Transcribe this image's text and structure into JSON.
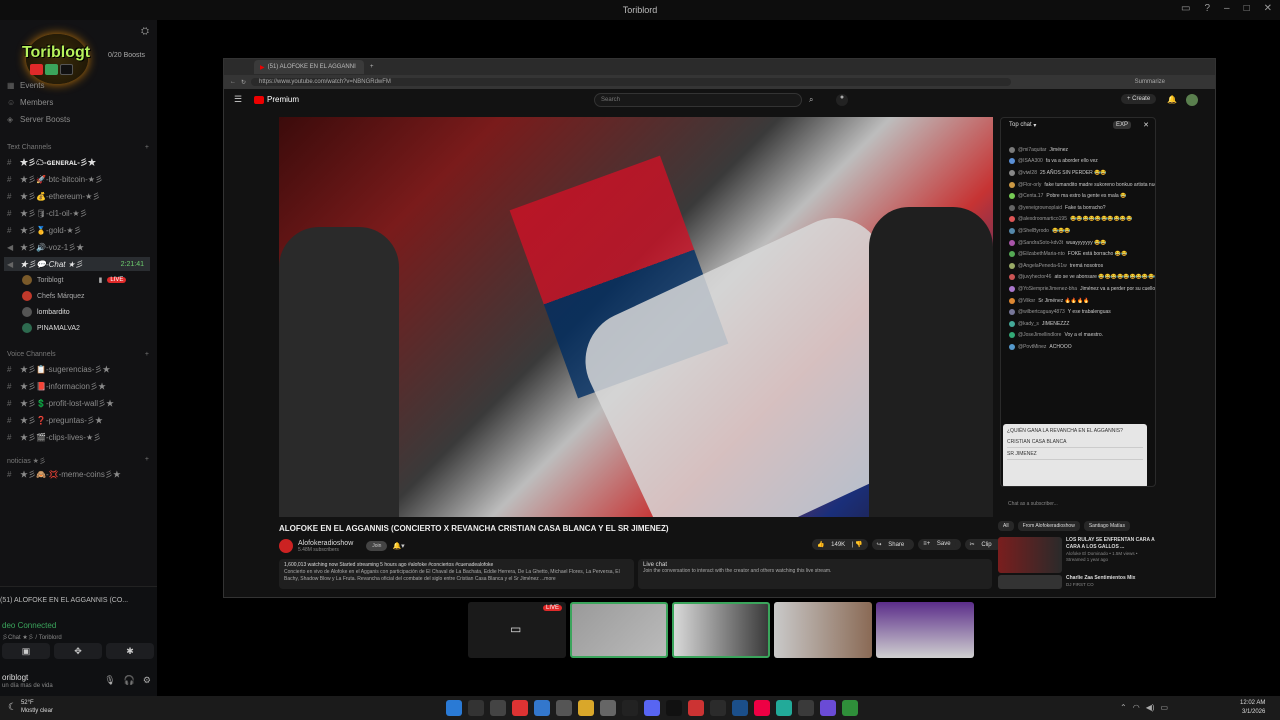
{
  "window": {
    "title": "Toriblord",
    "controls": [
      "▭",
      "?",
      "–",
      "□",
      "✕"
    ]
  },
  "server": {
    "logo_text": "Toriblogt",
    "boosts": "0/20 Boosts",
    "nav": [
      "Events",
      "Members",
      "Server Boosts"
    ]
  },
  "text_channels": {
    "title": "Text Channels",
    "items": [
      "★彡☁-ɢᴇɴᴇʀᴀʟ-彡★",
      "★彡🚀-btc-bitcoin-★彡",
      "★彡💰-ethereum-★彡",
      "★彡🛢-cl1-oil-★彡",
      "★彡🥇-gold-★彡",
      "★彡🔊-voz-1彡★",
      "★彡💬-Chat ★彡"
    ],
    "active_timer": "2:21:41"
  },
  "voice_users": [
    {
      "name": "Toriblogt",
      "live": "LIVE",
      "color": "#7a5a2a"
    },
    {
      "name": "Chefs Márquez",
      "color": "#c0392b"
    },
    {
      "name": "lombardito",
      "color": "#555555"
    },
    {
      "name": "PINAMALVA2",
      "color": "#2d6a4f"
    }
  ],
  "voice_channels": {
    "title": "Voice Channels",
    "items": [
      "★彡📋-sugerencias-彡★",
      "★彡📕-informacion彡★",
      "★彡💲-profit-lost-wall彡★",
      "★彡❓-preguntas-彡★",
      "★彡🎬-clips-lives-★彡"
    ]
  },
  "noticias": {
    "title": "noticias ★彡",
    "items": [
      "★彡🙈-💢-meme-coins彡★"
    ]
  },
  "voice_panel": {
    "stream": "(51) ALOFOKE EN EL AGGANNIS (CO...",
    "status": "deo Connected",
    "sub": "彡Chat ★彡 / Toriblord",
    "user": "oriblogt",
    "user_status": "un día mas de vida"
  },
  "browser": {
    "tab_title": "(51) ALOFOKE EN EL AGGANNI",
    "url": "https://www.youtube.com/watch?v=NBNGRdwFM",
    "summarize": "Summarize"
  },
  "youtube": {
    "brand": "Premium",
    "search_placeholder": "Search",
    "create": "+ Create",
    "video_title": "ALOFOKE EN EL AGGANNIS (CONCIERTO X REVANCHA CRISTIAN CASA BLANCA Y EL SR JIMENEZ)",
    "channel": "Alofokeradioshow",
    "subscribers": "5.48M subscribers",
    "join": "Join",
    "likes": "149K",
    "share": "Share",
    "save": "Save",
    "clip": "Clip",
    "description_meta": "1,600,013 watching now  Started streaming 5 hours ago  #alofoke #conciertos #cuenadealofoke",
    "description": "Concierto en vivo de Alofoke en el Agganis con participación de El Chaval de La Bachata, Eddie Herrera, De La Ghetto, Michael Flores, La Perversa, El Bachy, Shadow Blow y La Fruta. Revancha oficial del combate del siglo entre Cristian Casa Blanca y el Sr Jiménez  ...more",
    "live_chat_title": "Live chat",
    "live_chat_text": "Join the conversation to interact with the creator and others watching this live stream."
  },
  "chat": {
    "header": "Top chat",
    "exp": "EXP",
    "messages": [
      {
        "user": "@mi7aquitar",
        "text": "Jiménez",
        "color": "#7a7a7a"
      },
      {
        "user": "@ISAA300",
        "text": "fa va a aborder ello vez",
        "color": "#5a8fd6"
      },
      {
        "user": "@viwl28",
        "text": "25 AÑOS SIN PERDER 😂😂",
        "color": "#888"
      },
      {
        "user": "@Flor-orly",
        "text": "fake tumandito madre sukoreno bonkuo artista nuestro somo nuestro ke tamo prendio",
        "color": "#c94"
      },
      {
        "user": "@Centa.17",
        "text": "Pobre ma estro la gente es mala 😂",
        "color": "#7c5"
      },
      {
        "user": "@yeneigrownoplaid",
        "text": "Fake ta borracho?",
        "color": "#666"
      },
      {
        "user": "@alexdroomartico195",
        "text": "😂😂😂😂😂😂😂😂😂😂",
        "color": "#d55"
      },
      {
        "user": "@ShelByrodo",
        "text": "😂😂😂",
        "color": "#58a"
      },
      {
        "user": "@SandraSoto-kdv3t",
        "text": "wuayyyyyyy 😂😂",
        "color": "#a5a"
      },
      {
        "user": "@EilzabethMaria-nto",
        "text": "FOKE está borracho 😂😂",
        "color": "#5a5"
      },
      {
        "user": "@AngelaPeneda-61w",
        "text": "tremá nosotros",
        "color": "#9a6"
      },
      {
        "user": "@juvyhector46",
        "text": "ato se ve abonsare 😂😂😂😂😂😂😂😂😂😂",
        "color": "#c55"
      },
      {
        "user": "@YoSiemprieJimenez-bha",
        "text": "Jiménez va a perder por su cuello",
        "color": "#a7c"
      },
      {
        "user": "@Vilksr",
        "text": "Sr Jiménez 🔥🔥🔥🔥",
        "color": "#d83"
      },
      {
        "user": "@wilbertcaguay4873",
        "text": "Y ese trabalenguas",
        "color": "#779"
      },
      {
        "user": "@kady_s",
        "text": "JIMENEZZZ",
        "color": "#4a9"
      },
      {
        "user": "@JoseJimellindlore",
        "text": "Voy a el maestro.",
        "color": "#3a7"
      },
      {
        "user": "@PovtMinez",
        "text": "ACHOOO",
        "color": "#59c"
      }
    ],
    "poll": {
      "question": "¿QUIÉN GANA LA REVANCHA EN EL AGGANNIS?",
      "options": [
        "CRISTIAN CASA BLANCA",
        "SR JIMENEZ"
      ]
    },
    "input_placeholder": "Chat as a subscriber..."
  },
  "recommendations": {
    "chips": [
      "All",
      "From Alofokeradioshow",
      "Santiago Matías"
    ],
    "items": [
      {
        "title": "LOS RULAY SE ENFRENTAN CARA A CARA A LOS GALLOS ...",
        "meta": "Alofoke El Dominado • 1.5M views • Streamed 1 year ago"
      },
      {
        "title": "Charlie Zaa Sentimientos Mix",
        "meta": "DJ FIRST CO"
      }
    ]
  },
  "thumbnails": {
    "live_label": "LIVE"
  },
  "taskbar": {
    "temp": "52°F",
    "weather": "Mostly clear",
    "time": "12:02 AM",
    "date": "3/1/2026"
  }
}
